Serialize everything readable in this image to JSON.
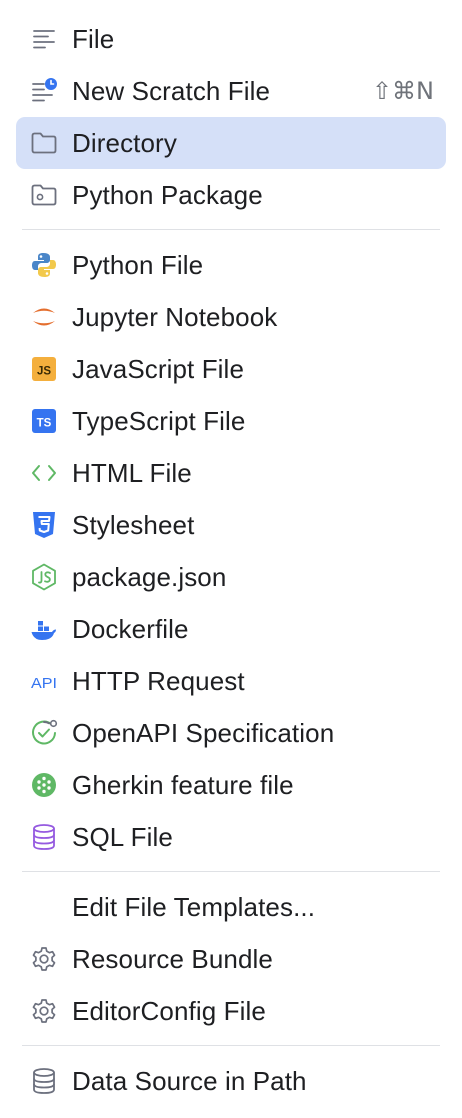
{
  "menu": {
    "items": [
      {
        "label": "File",
        "icon": "text-file-icon"
      },
      {
        "label": "New Scratch File",
        "icon": "scratch-file-icon",
        "shortcut": "⇧⌘N"
      },
      {
        "label": "Directory",
        "icon": "folder-icon",
        "selected": true
      },
      {
        "label": "Python Package",
        "icon": "package-folder-icon"
      },
      {
        "label": "Python File",
        "icon": "python-icon"
      },
      {
        "label": "Jupyter Notebook",
        "icon": "jupyter-icon"
      },
      {
        "label": "JavaScript File",
        "icon": "javascript-icon",
        "badge": "JS"
      },
      {
        "label": "TypeScript File",
        "icon": "typescript-icon",
        "badge": "TS"
      },
      {
        "label": "HTML File",
        "icon": "html-icon"
      },
      {
        "label": "Stylesheet",
        "icon": "css-icon"
      },
      {
        "label": "package.json",
        "icon": "nodejs-icon"
      },
      {
        "label": "Dockerfile",
        "icon": "docker-icon"
      },
      {
        "label": "HTTP Request",
        "icon": "api-icon",
        "badge": "API"
      },
      {
        "label": "OpenAPI Specification",
        "icon": "openapi-icon"
      },
      {
        "label": "Gherkin feature file",
        "icon": "cucumber-icon"
      },
      {
        "label": "SQL File",
        "icon": "sql-database-icon"
      },
      {
        "label": "Edit File Templates...",
        "icon": ""
      },
      {
        "label": "Resource Bundle",
        "icon": "gear-icon"
      },
      {
        "label": "EditorConfig File",
        "icon": "gear-icon"
      },
      {
        "label": "Data Source in Path",
        "icon": "database-icon"
      }
    ]
  },
  "colors": {
    "selected_background": "#d5e0f8",
    "text": "#1e1f22",
    "shortcut": "#6f737a",
    "separator": "#dfe1e5",
    "js_badge": "#f4af3d",
    "ts_badge": "#3574f0",
    "python_blue": "#4a86c8",
    "python_yellow": "#f2c94c",
    "jupyter_orange": "#e46e2e",
    "html_green": "#5fb865",
    "css_blue": "#3574f0",
    "node_green": "#5fb865",
    "docker_blue": "#3574f0",
    "api_blue": "#3574f0",
    "cucumber_green": "#5fb865",
    "sql_purple": "#955ae0",
    "gray_icon": "#6c707e"
  }
}
